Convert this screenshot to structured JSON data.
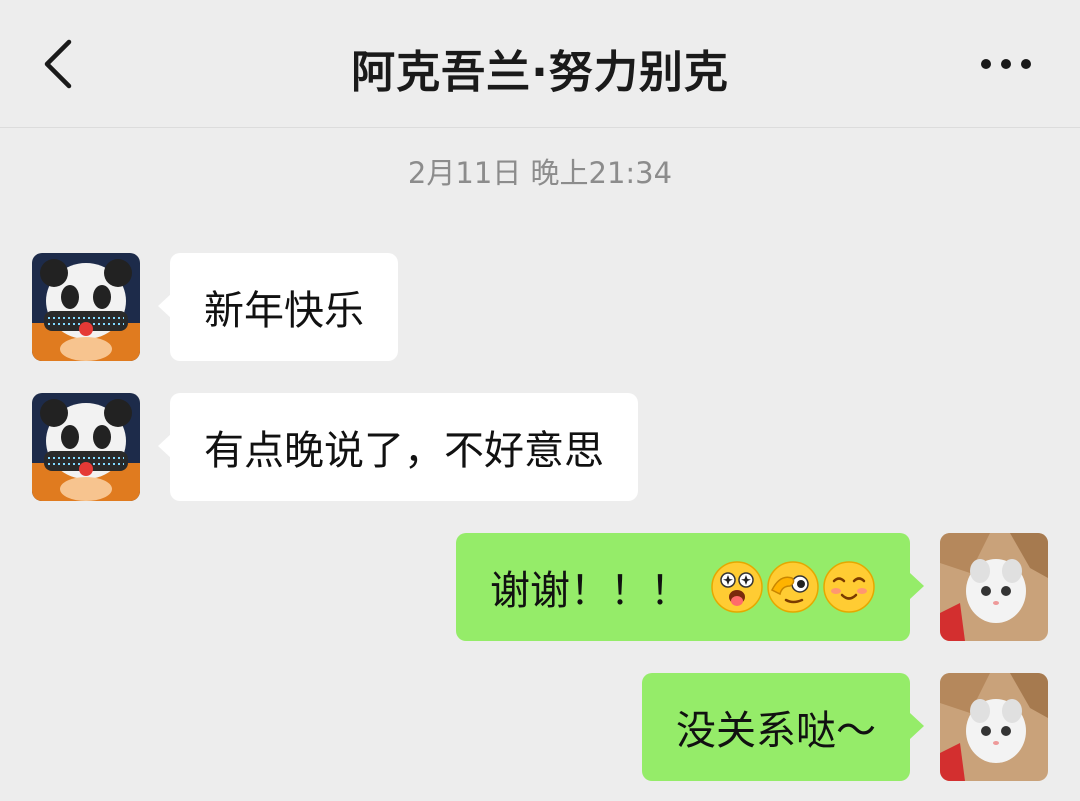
{
  "header": {
    "title": "阿克吾兰·努力别克",
    "back_icon": "chevron-left-icon",
    "more_icon": "more-dots-icon"
  },
  "timestamp": "2月11日 晚上21:34",
  "messages": [
    {
      "side": "incoming",
      "text": "新年快乐"
    },
    {
      "side": "incoming",
      "text": "有点晚说了，不好意思"
    },
    {
      "side": "outgoing",
      "text": "谢谢！！！",
      "emojis": [
        "starstruck-tongue-emoji",
        "ok-hand-eye-emoji",
        "blushing-smile-emoji"
      ]
    },
    {
      "side": "outgoing",
      "text": "没关系哒～"
    }
  ],
  "colors": {
    "background": "#ededed",
    "outgoing_bubble": "#95ec69",
    "incoming_bubble": "#ffffff",
    "timestamp": "#8c8c8c"
  }
}
